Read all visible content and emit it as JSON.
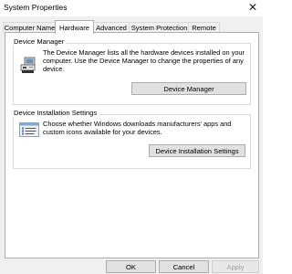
{
  "window": {
    "title": "System Properties",
    "close_glyph": "✕"
  },
  "tabs": [
    {
      "label": "Computer Name"
    },
    {
      "label": "Hardware"
    },
    {
      "label": "Advanced"
    },
    {
      "label": "System Protection"
    },
    {
      "label": "Remote"
    }
  ],
  "active_tab": "Hardware",
  "device_manager": {
    "title": "Device Manager",
    "description": "The Device Manager lists all the hardware devices installed on your computer. Use the Device Manager to change the properties of any device.",
    "button": "Device Manager",
    "icon": "device-manager-icon"
  },
  "device_installation": {
    "title": "Device Installation Settings",
    "description": "Choose whether Windows downloads manufacturers' apps and custom icons available for your devices.",
    "button": "Device Installation Settings",
    "icon": "device-installation-icon"
  },
  "footer": {
    "ok": "OK",
    "cancel": "Cancel",
    "apply": "Apply"
  }
}
